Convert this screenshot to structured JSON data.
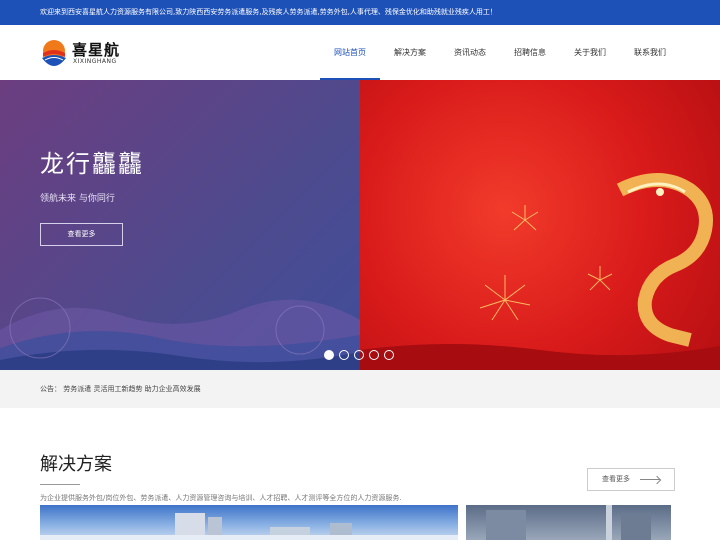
{
  "topbar": {
    "welcome_text": "欢迎来到西安喜星航人力资源服务有限公司,致力陕西西安劳务派遣服务,及残疾人劳务派遣,劳务外包,人事代理、残保金优化和助残就业残疾人用工！"
  },
  "logo": {
    "name_cn": "喜星航",
    "name_en": "XIXINGHANG"
  },
  "nav": {
    "items": [
      {
        "label": "网站首页",
        "active": true
      },
      {
        "label": "解决方案",
        "active": false
      },
      {
        "label": "资讯动态",
        "active": false
      },
      {
        "label": "招聘信息",
        "active": false
      },
      {
        "label": "关于我们",
        "active": false
      },
      {
        "label": "联系我们",
        "active": false
      }
    ]
  },
  "banner": {
    "title": "龙行龘龘",
    "subtitle": "领航未来 与你同行",
    "button_label": "查看更多",
    "slide_count": 5,
    "active_slide": 1
  },
  "notice": {
    "text": "公告： 劳务派遣 灵活用工新趋势 助力企业高效发展"
  },
  "solutions": {
    "title": "解决方案",
    "description": "为企业提供服务外包/岗位外包、劳务派遣、人力资源管理咨询与培训、人才招聘、人才测评等全方位的人力资源服务.",
    "more_label": "查看更多"
  },
  "colors": {
    "brand_blue": "#1e51b8",
    "banner_purple": "#5a4890",
    "banner_red": "#d81a1a"
  }
}
